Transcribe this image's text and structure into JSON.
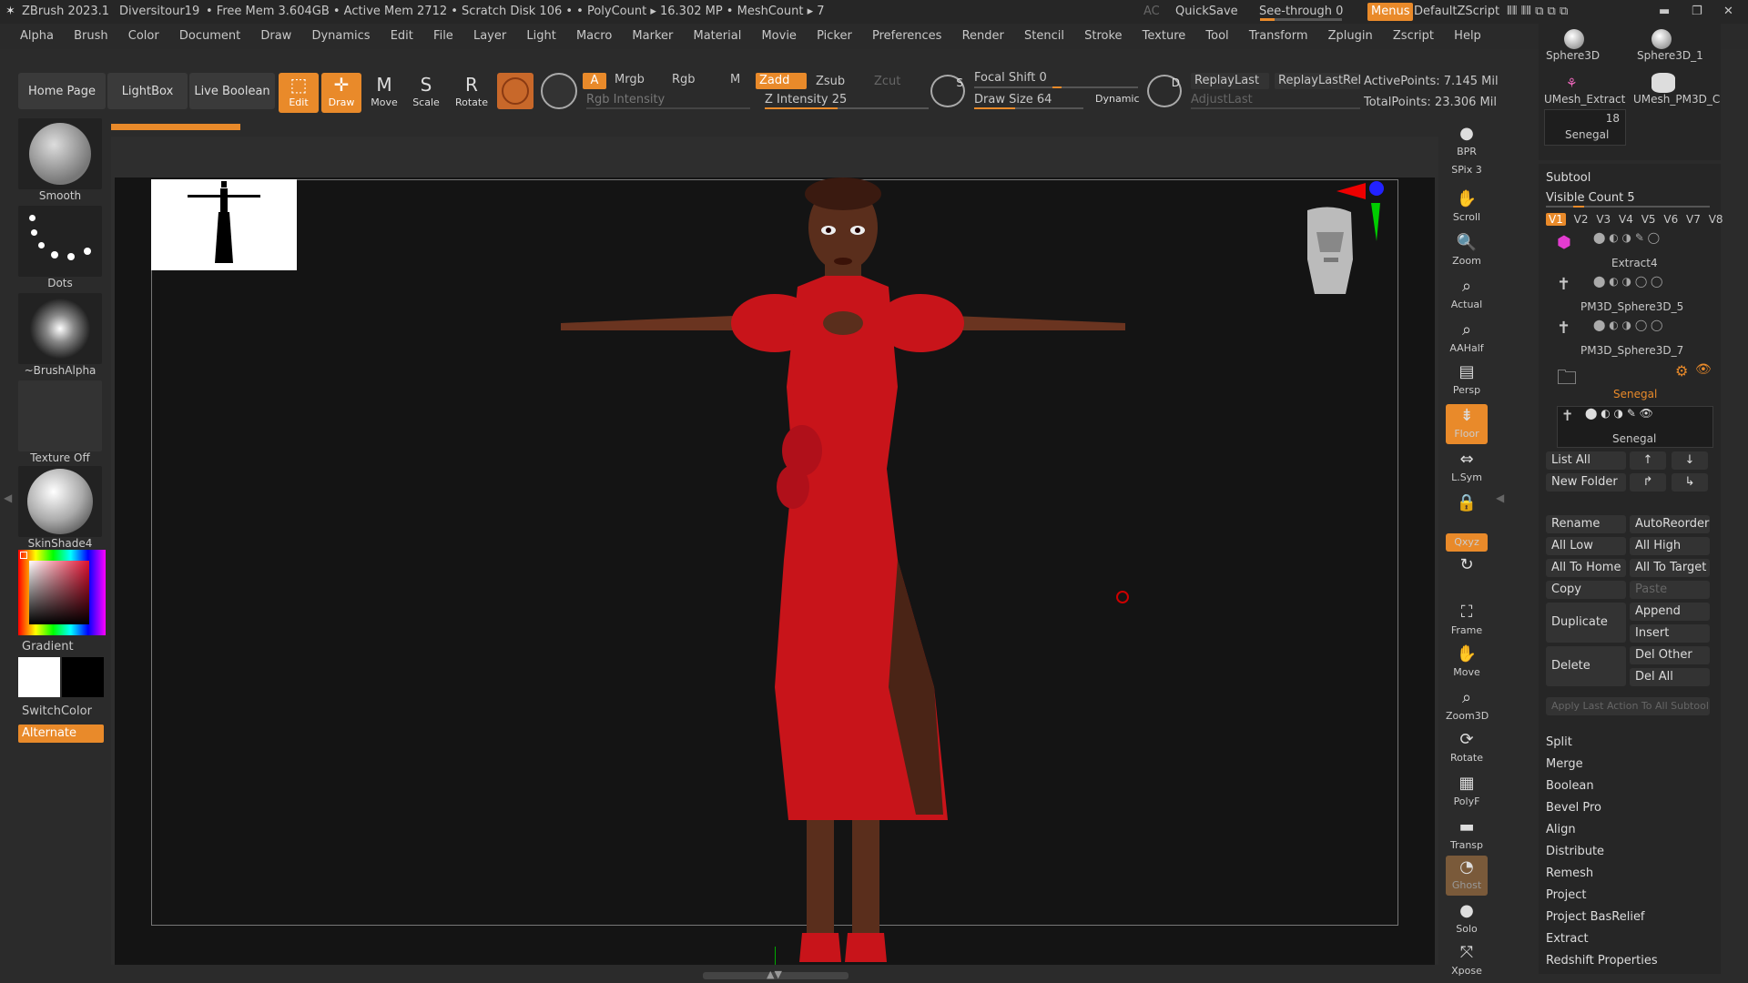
{
  "titlebar": {
    "app": "ZBrush 2023.1",
    "project": "Diversitour19",
    "stats": "• Free Mem 3.604GB • Active Mem 2712 • Scratch Disk 106 •  • PolyCount ▸ 16.302 MP  • MeshCount ▸ 7",
    "ac": "AC",
    "quicksave": "QuickSave",
    "see_through": "See-through  0",
    "menus": "Menus",
    "script": "DefaultZScript"
  },
  "menu": [
    "Alpha",
    "Brush",
    "Color",
    "Document",
    "Draw",
    "Dynamics",
    "Edit",
    "File",
    "Layer",
    "Light",
    "Macro",
    "Marker",
    "Material",
    "Movie",
    "Picker",
    "Preferences",
    "Render",
    "Stencil",
    "Stroke",
    "Texture",
    "Tool",
    "Transform",
    "Zplugin",
    "Zscript",
    "Help"
  ],
  "toolbar": {
    "home": "Home Page",
    "lightbox": "LightBox",
    "live_boolean": "Live Boolean",
    "edit": "Edit",
    "draw": "Draw",
    "move": "Move",
    "scale": "Scale",
    "rotate": "Rotate",
    "a": "A",
    "mrgb": "Mrgb",
    "rgb": "Rgb",
    "m": "M",
    "zadd": "Zadd",
    "zsub": "Zsub",
    "zcut": "Zcut",
    "rgb_intensity": "Rgb Intensity",
    "z_intensity": "Z Intensity 25",
    "focal_shift": "Focal Shift 0",
    "draw_size": "Draw Size 64",
    "dynamic": "Dynamic",
    "replay_last": "ReplayLast",
    "replay_last_rel": "ReplayLastRel",
    "adjust_last": "AdjustLast",
    "active_points": "ActivePoints: 7.145 Mil",
    "total_points": "TotalPoints: 23.306 Mil"
  },
  "left_shelf": {
    "smooth": "Smooth",
    "dots": "Dots",
    "brush_alpha": "~BrushAlpha",
    "texture_off": "Texture Off",
    "material": "SkinShade4",
    "gradient": "Gradient",
    "switch_color": "SwitchColor",
    "alternate": "Alternate"
  },
  "right_shelf": [
    "BPR",
    "SPix 3",
    "Scroll",
    "Zoom",
    "Actual",
    "AAHalf",
    "Persp",
    "Floor",
    "L.Sym",
    "Qxyz",
    "Frame",
    "Move",
    "Zoom3D",
    "Rotate",
    "PolyF",
    "Transp",
    "Ghost",
    "Solo",
    "Xpose"
  ],
  "tool_thumbs": {
    "sphere3d": "Sphere3D",
    "sphere3d_1": "Sphere3D_1",
    "umesh_extract": "UMesh_Extract",
    "umesh_pm3d": "UMesh_PM3D_C",
    "count": "18",
    "current": "Senegal"
  },
  "subtool": {
    "title": "Subtool",
    "visible_count": "Visible Count 5",
    "versions": [
      "V1",
      "V2",
      "V3",
      "V4",
      "V5",
      "V6",
      "V7",
      "V8"
    ],
    "items": [
      "Extract4",
      "PM3D_Sphere3D_5",
      "PM3D_Sphere3D_7",
      "Senegal",
      "Senegal"
    ],
    "list_all": "List All",
    "new_folder": "New Folder",
    "rename": "Rename",
    "auto_reorder": "AutoReorder",
    "all_low": "All Low",
    "all_high": "All High",
    "all_to_home": "All To Home",
    "all_to_target": "All To Target",
    "copy": "Copy",
    "paste": "Paste",
    "duplicate": "Duplicate",
    "append": "Append",
    "insert": "Insert",
    "delete": "Delete",
    "del_other": "Del Other",
    "del_all": "Del All",
    "apply_last": "Apply Last Action To All Subtool",
    "sections": [
      "Split",
      "Merge",
      "Boolean",
      "Bevel Pro",
      "Align",
      "Distribute",
      "Remesh",
      "Project",
      "Project BasRelief",
      "Extract",
      "Redshift Properties"
    ]
  },
  "colors": {
    "accent": "#e98a2a",
    "dress": "#c8141a",
    "skin": "#5a2e1c"
  }
}
